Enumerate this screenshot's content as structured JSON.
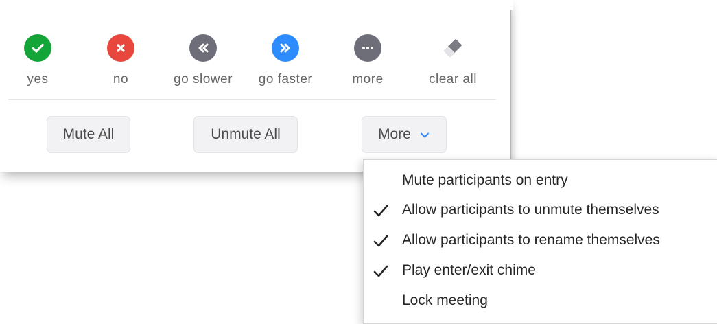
{
  "reactions": [
    {
      "label": "yes",
      "icon": "check-icon",
      "color": "#13a538"
    },
    {
      "label": "no",
      "icon": "close-icon",
      "color": "#e8473d"
    },
    {
      "label": "go slower",
      "icon": "rewind-icon",
      "color": "#6e6e78"
    },
    {
      "label": "go faster",
      "icon": "fast-forward-icon",
      "color": "#2d8cff"
    },
    {
      "label": "more",
      "icon": "ellipsis-icon",
      "color": "#6e6e78"
    },
    {
      "label": "clear all",
      "icon": "eraser-icon",
      "color": "#7a7a82"
    }
  ],
  "actions": {
    "mute_all": "Mute All",
    "unmute_all": "Unmute All",
    "more": "More"
  },
  "menu": {
    "items": [
      {
        "label": "Mute participants on entry",
        "checked": false
      },
      {
        "label": "Allow participants to unmute themselves",
        "checked": true
      },
      {
        "label": "Allow participants to rename themselves",
        "checked": true
      },
      {
        "label": "Play enter/exit chime",
        "checked": true
      },
      {
        "label": "Lock meeting",
        "checked": false
      }
    ]
  },
  "colors": {
    "accent": "#2d8cff",
    "text": "#262626",
    "label": "#666666"
  }
}
